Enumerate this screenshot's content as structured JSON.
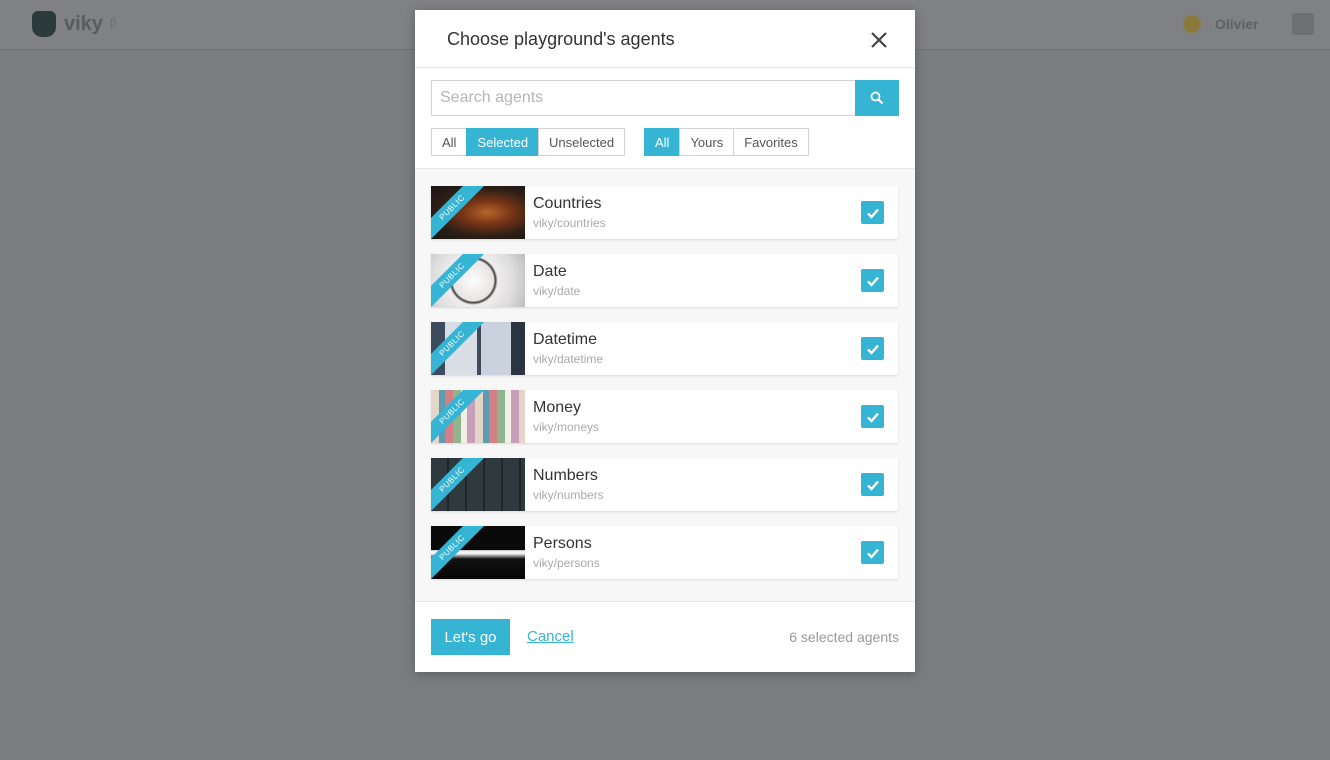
{
  "app": {
    "name": "viky",
    "version": "β",
    "user_name": "Olivier"
  },
  "modal": {
    "title": "Choose playground's agents",
    "search_placeholder": "Search agents",
    "selection_filters": [
      {
        "label": "All",
        "active": false
      },
      {
        "label": "Selected",
        "active": true
      },
      {
        "label": "Unselected",
        "active": false
      }
    ],
    "owner_filters": [
      {
        "label": "All",
        "active": true
      },
      {
        "label": "Yours",
        "active": false
      },
      {
        "label": "Favorites",
        "active": false
      }
    ],
    "agents": [
      {
        "name": "Countries",
        "slug": "viky/countries",
        "badge": "PUBLIC",
        "checked": true,
        "thumb": "countries"
      },
      {
        "name": "Date",
        "slug": "viky/date",
        "badge": "PUBLIC",
        "checked": true,
        "thumb": "date"
      },
      {
        "name": "Datetime",
        "slug": "viky/datetime",
        "badge": "PUBLIC",
        "checked": true,
        "thumb": "datetime"
      },
      {
        "name": "Money",
        "slug": "viky/moneys",
        "badge": "PUBLIC",
        "checked": true,
        "thumb": "money"
      },
      {
        "name": "Numbers",
        "slug": "viky/numbers",
        "badge": "PUBLIC",
        "checked": true,
        "thumb": "numbers"
      },
      {
        "name": "Persons",
        "slug": "viky/persons",
        "badge": "PUBLIC",
        "checked": true,
        "thumb": "persons"
      }
    ],
    "footer": {
      "primary_label": "Let's go",
      "cancel_label": "Cancel",
      "selected_count": "6 selected agents"
    }
  },
  "colors": {
    "accent": "#35b4d4",
    "overlay": "#7b7c7e"
  },
  "icons": {
    "close": "close-icon",
    "search": "search-icon",
    "check": "check-icon"
  }
}
